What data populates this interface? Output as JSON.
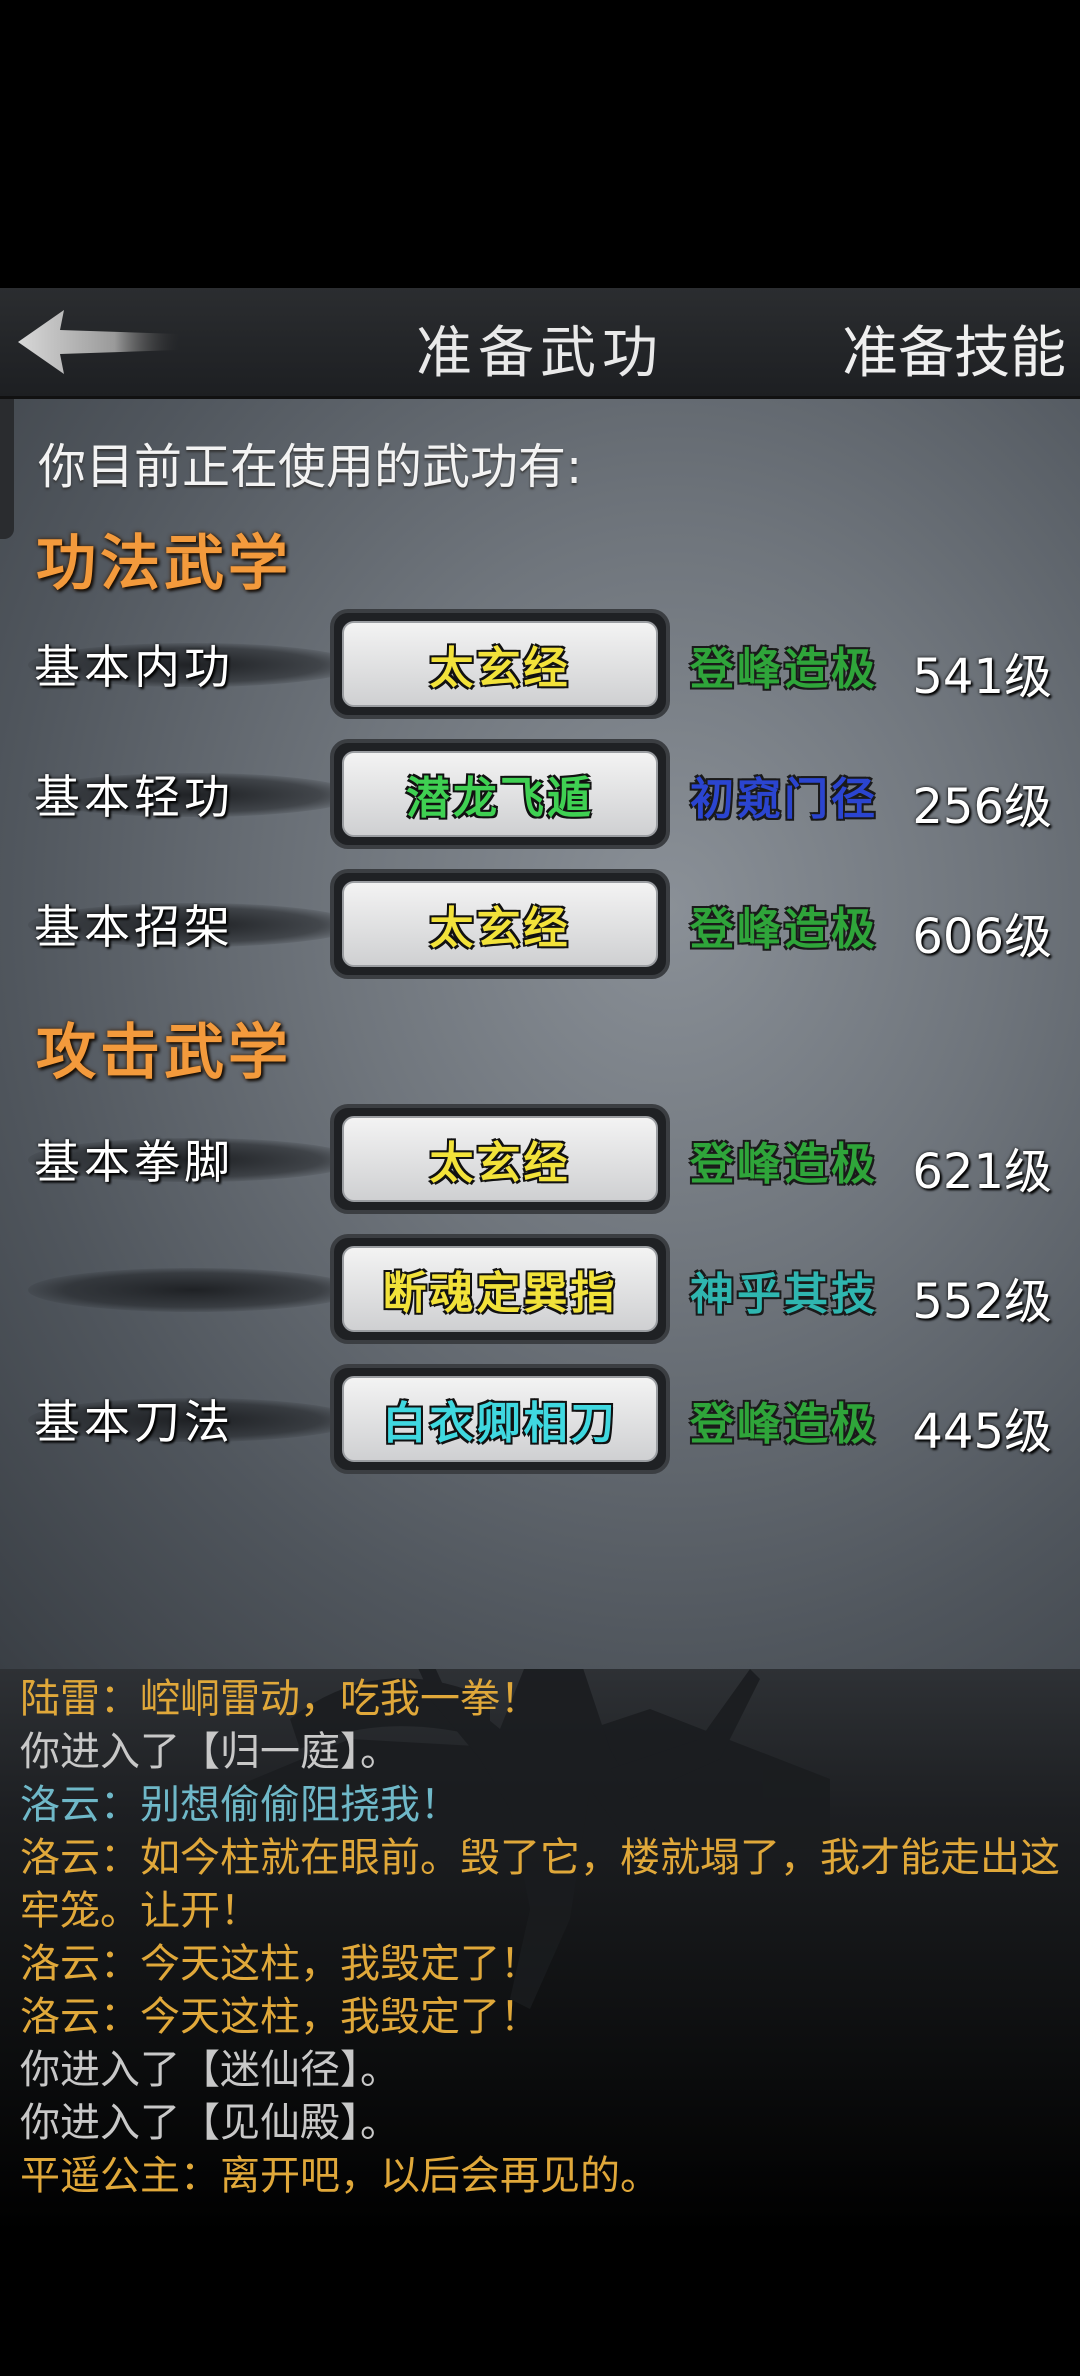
{
  "header": {
    "title": "准备武功",
    "right_button": "准备技能"
  },
  "intro_text": "你目前正在使用的武功有:",
  "sections": [
    {
      "title": "功法武学",
      "rows": [
        {
          "slot": "基本内功",
          "skill": "太玄经",
          "skill_color": "#f2e23a",
          "level": "登峰造极",
          "level_color": "#2fa53a",
          "number": "541级"
        },
        {
          "slot": "基本轻功",
          "skill": "潜龙飞遁",
          "skill_color": "#3fd052",
          "level": "初窥门径",
          "level_color": "#2b45d0",
          "number": "256级"
        },
        {
          "slot": "基本招架",
          "skill": "太玄经",
          "skill_color": "#f2e23a",
          "level": "登峰造极",
          "level_color": "#2fa53a",
          "number": "606级"
        }
      ]
    },
    {
      "title": "攻击武学",
      "rows": [
        {
          "slot": "基本拳脚",
          "skill": "太玄经",
          "skill_color": "#f2e23a",
          "level": "登峰造极",
          "level_color": "#2fa53a",
          "number": "621级"
        },
        {
          "slot": "",
          "skill": "断魂定巽指",
          "skill_color": "#f2e23a",
          "level": "神乎其技",
          "level_color": "#2fb6b0",
          "number": "552级"
        },
        {
          "slot": "基本刀法",
          "skill": "白衣卿相刀",
          "skill_color": "#3fd8e0",
          "level": "登峰造极",
          "level_color": "#2fa53a",
          "number": "445级"
        }
      ]
    }
  ],
  "log": [
    {
      "text": "陆雷：崆峒雷动，吃我一拳！",
      "color": "#e0a83a"
    },
    {
      "text": "你进入了【归一庭】。",
      "color": "#c8c8c8"
    },
    {
      "text": "洛云：别想偷偷阻挠我！",
      "color": "#6fb8c8"
    },
    {
      "text": "洛云：如今柱就在眼前。毁了它，楼就塌了，我才能走出这牢笼。让开！",
      "color": "#e0a83a"
    },
    {
      "text": "洛云：今天这柱，我毁定了！",
      "color": "#e0a83a"
    },
    {
      "text": "洛云：今天这柱，我毁定了！",
      "color": "#e0a83a"
    },
    {
      "text": "你进入了【迷仙径】。",
      "color": "#c8c8c8"
    },
    {
      "text": "你进入了【见仙殿】。",
      "color": "#c8c8c8"
    },
    {
      "text": "平遥公主：离开吧，以后会再见的。",
      "color": "#e0a83a"
    }
  ],
  "icons": {
    "back": "back-arrow-icon",
    "scenery": "warrior-silhouette-icon"
  }
}
